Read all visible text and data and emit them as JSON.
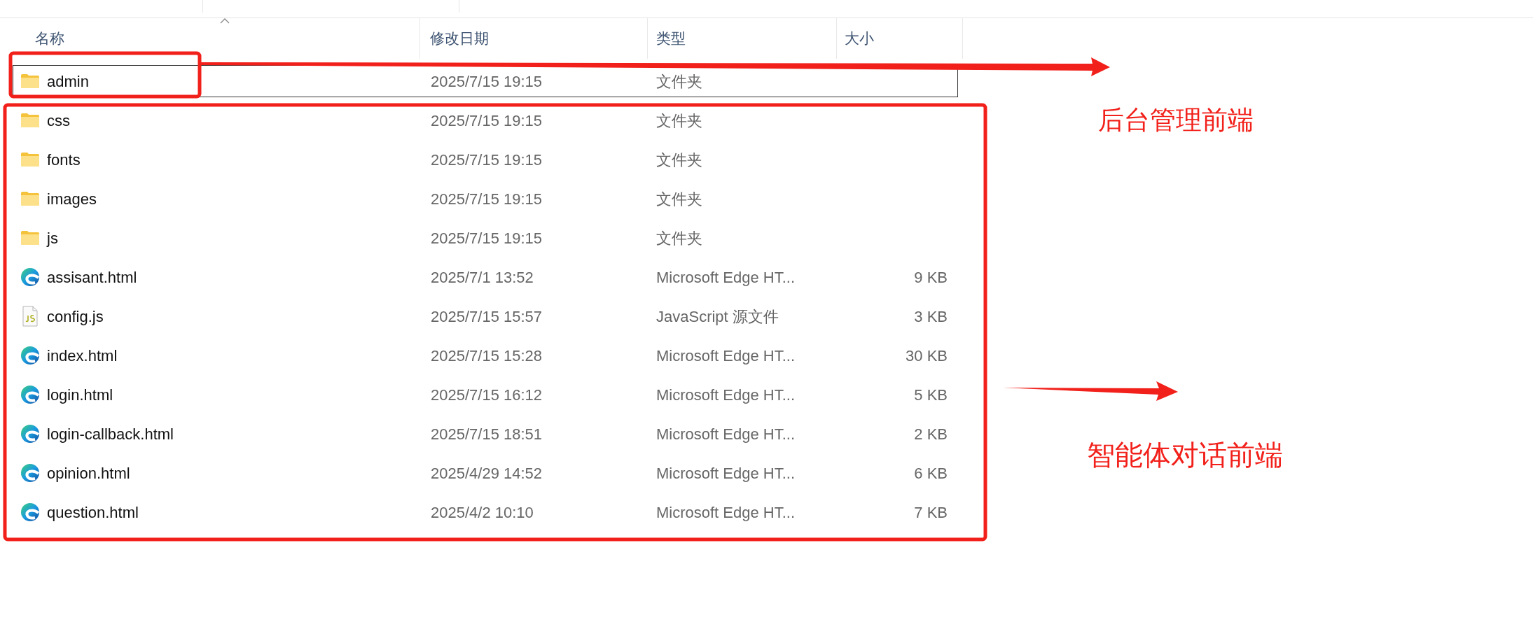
{
  "columns": [
    {
      "label": "名称",
      "sorted": true
    },
    {
      "label": "修改日期",
      "sorted": false
    },
    {
      "label": "类型",
      "sorted": false
    },
    {
      "label": "大小",
      "sorted": false
    }
  ],
  "rows": [
    {
      "kind": "folder",
      "name": "admin",
      "date": "2025/7/15 19:15",
      "type": "文件夹",
      "focused": true
    },
    {
      "kind": "folder",
      "name": "css",
      "date": "2025/7/15 19:15",
      "type": "文件夹",
      "focused": false
    },
    {
      "kind": "folder",
      "name": "fonts",
      "date": "2025/7/15 19:15",
      "type": "文件夹",
      "focused": false
    },
    {
      "kind": "folder",
      "name": "images",
      "date": "2025/7/15 19:15",
      "type": "文件夹",
      "focused": false
    },
    {
      "kind": "folder",
      "name": "js",
      "date": "2025/7/15 19:15",
      "type": "文件夹",
      "focused": false
    },
    {
      "kind": "edge",
      "name": "assisant.html",
      "date": "2025/7/1 13:52",
      "type": "Microsoft Edge HT...",
      "size": "9 KB",
      "focused": false
    },
    {
      "kind": "js",
      "name": "config.js",
      "date": "2025/7/15 15:57",
      "type": "JavaScript 源文件",
      "size": "3 KB",
      "focused": false
    },
    {
      "kind": "edge",
      "name": "index.html",
      "date": "2025/7/15 15:28",
      "type": "Microsoft Edge HT...",
      "size": "30 KB",
      "focused": false
    },
    {
      "kind": "edge",
      "name": "login.html",
      "date": "2025/7/15 16:12",
      "type": "Microsoft Edge HT...",
      "size": "5 KB",
      "focused": false
    },
    {
      "kind": "edge",
      "name": "login-callback.html",
      "date": "2025/7/15 18:51",
      "type": "Microsoft Edge HT...",
      "size": "2 KB",
      "focused": false
    },
    {
      "kind": "edge",
      "name": "opinion.html",
      "date": "2025/4/29 14:52",
      "type": "Microsoft Edge HT...",
      "size": "6 KB",
      "focused": false
    },
    {
      "kind": "edge",
      "name": "question.html",
      "date": "2025/4/2 10:10",
      "type": "Microsoft Edge HT...",
      "size": "7 KB",
      "focused": false
    }
  ],
  "annotations": [
    {
      "text": "后台管理前端"
    },
    {
      "text": "智能体对话前端"
    }
  ]
}
